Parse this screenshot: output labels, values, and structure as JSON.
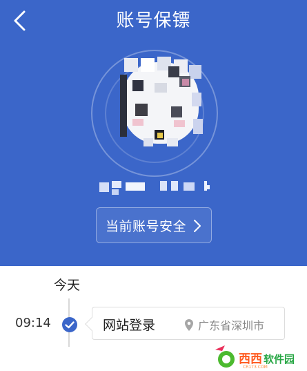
{
  "header": {
    "title": "账号保镖",
    "back_icon": "chevron-left-icon",
    "security_button_label": "当前账号安全",
    "security_chevron_icon": "chevron-right-icon",
    "brand_color": "#3b66c9"
  },
  "timeline": {
    "day_label": "今天",
    "events": [
      {
        "time": "09:14",
        "title": "网站登录",
        "location": "广东省深圳市",
        "status_icon": "check-circle-icon",
        "location_icon": "map-pin-icon"
      }
    ]
  },
  "watermark": {
    "text": "西西软件园",
    "sub_text": "CR173.COM"
  }
}
